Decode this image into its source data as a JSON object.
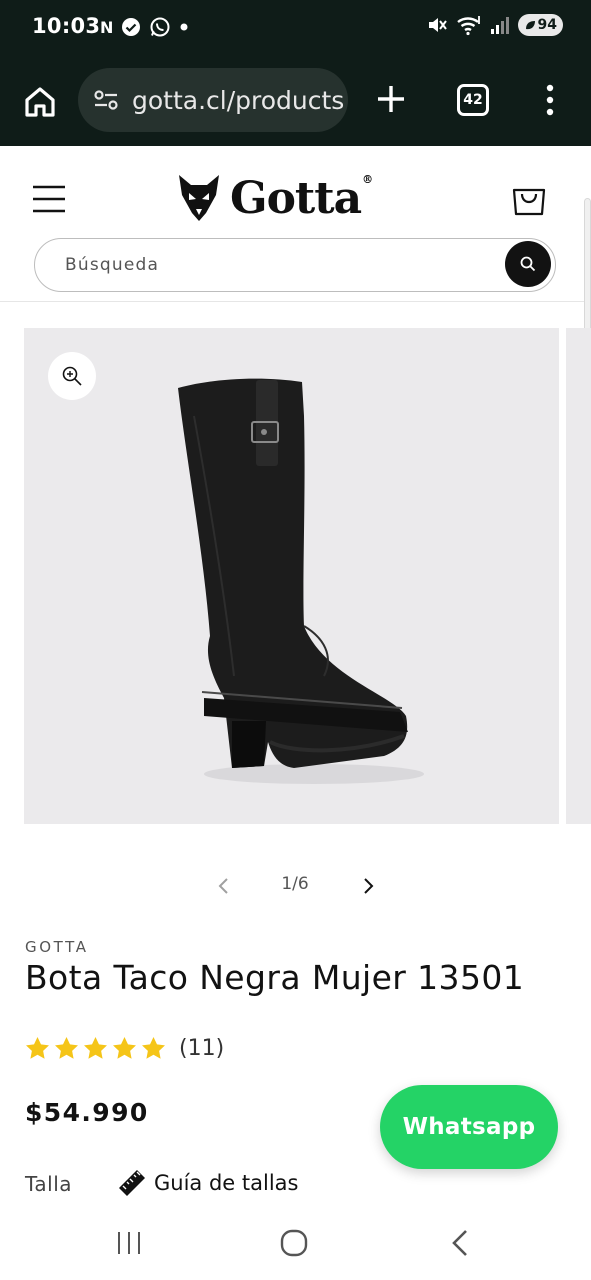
{
  "status_bar": {
    "time": "10:03",
    "notification_icons": [
      "n-icon",
      "check-badge-icon",
      "whatsapp-icon",
      "dot-icon"
    ],
    "system_icons": [
      "mute-icon",
      "wifi-icon",
      "signal-icon"
    ],
    "battery": "94"
  },
  "browser": {
    "url": "gotta.cl/products",
    "tab_count": "42"
  },
  "header": {
    "logo_text": "Gotta",
    "logo_reg": "®",
    "search": {
      "placeholder": "Búsqueda"
    }
  },
  "gallery": {
    "counter": "1/6"
  },
  "product": {
    "vendor": "GOTTA",
    "title": "Bota Taco Negra Mujer 13501",
    "rating": 5,
    "review_count": "(11)",
    "price": "$54.990",
    "size_label": "Talla",
    "size_guide": "Guía de tallas"
  },
  "whatsapp": {
    "label": "Whatsapp"
  },
  "colors": {
    "browser_bg": "#0f1c18",
    "star": "#f5c518",
    "whatsapp": "#24d366",
    "gallery_bg": "#ebeaec"
  }
}
